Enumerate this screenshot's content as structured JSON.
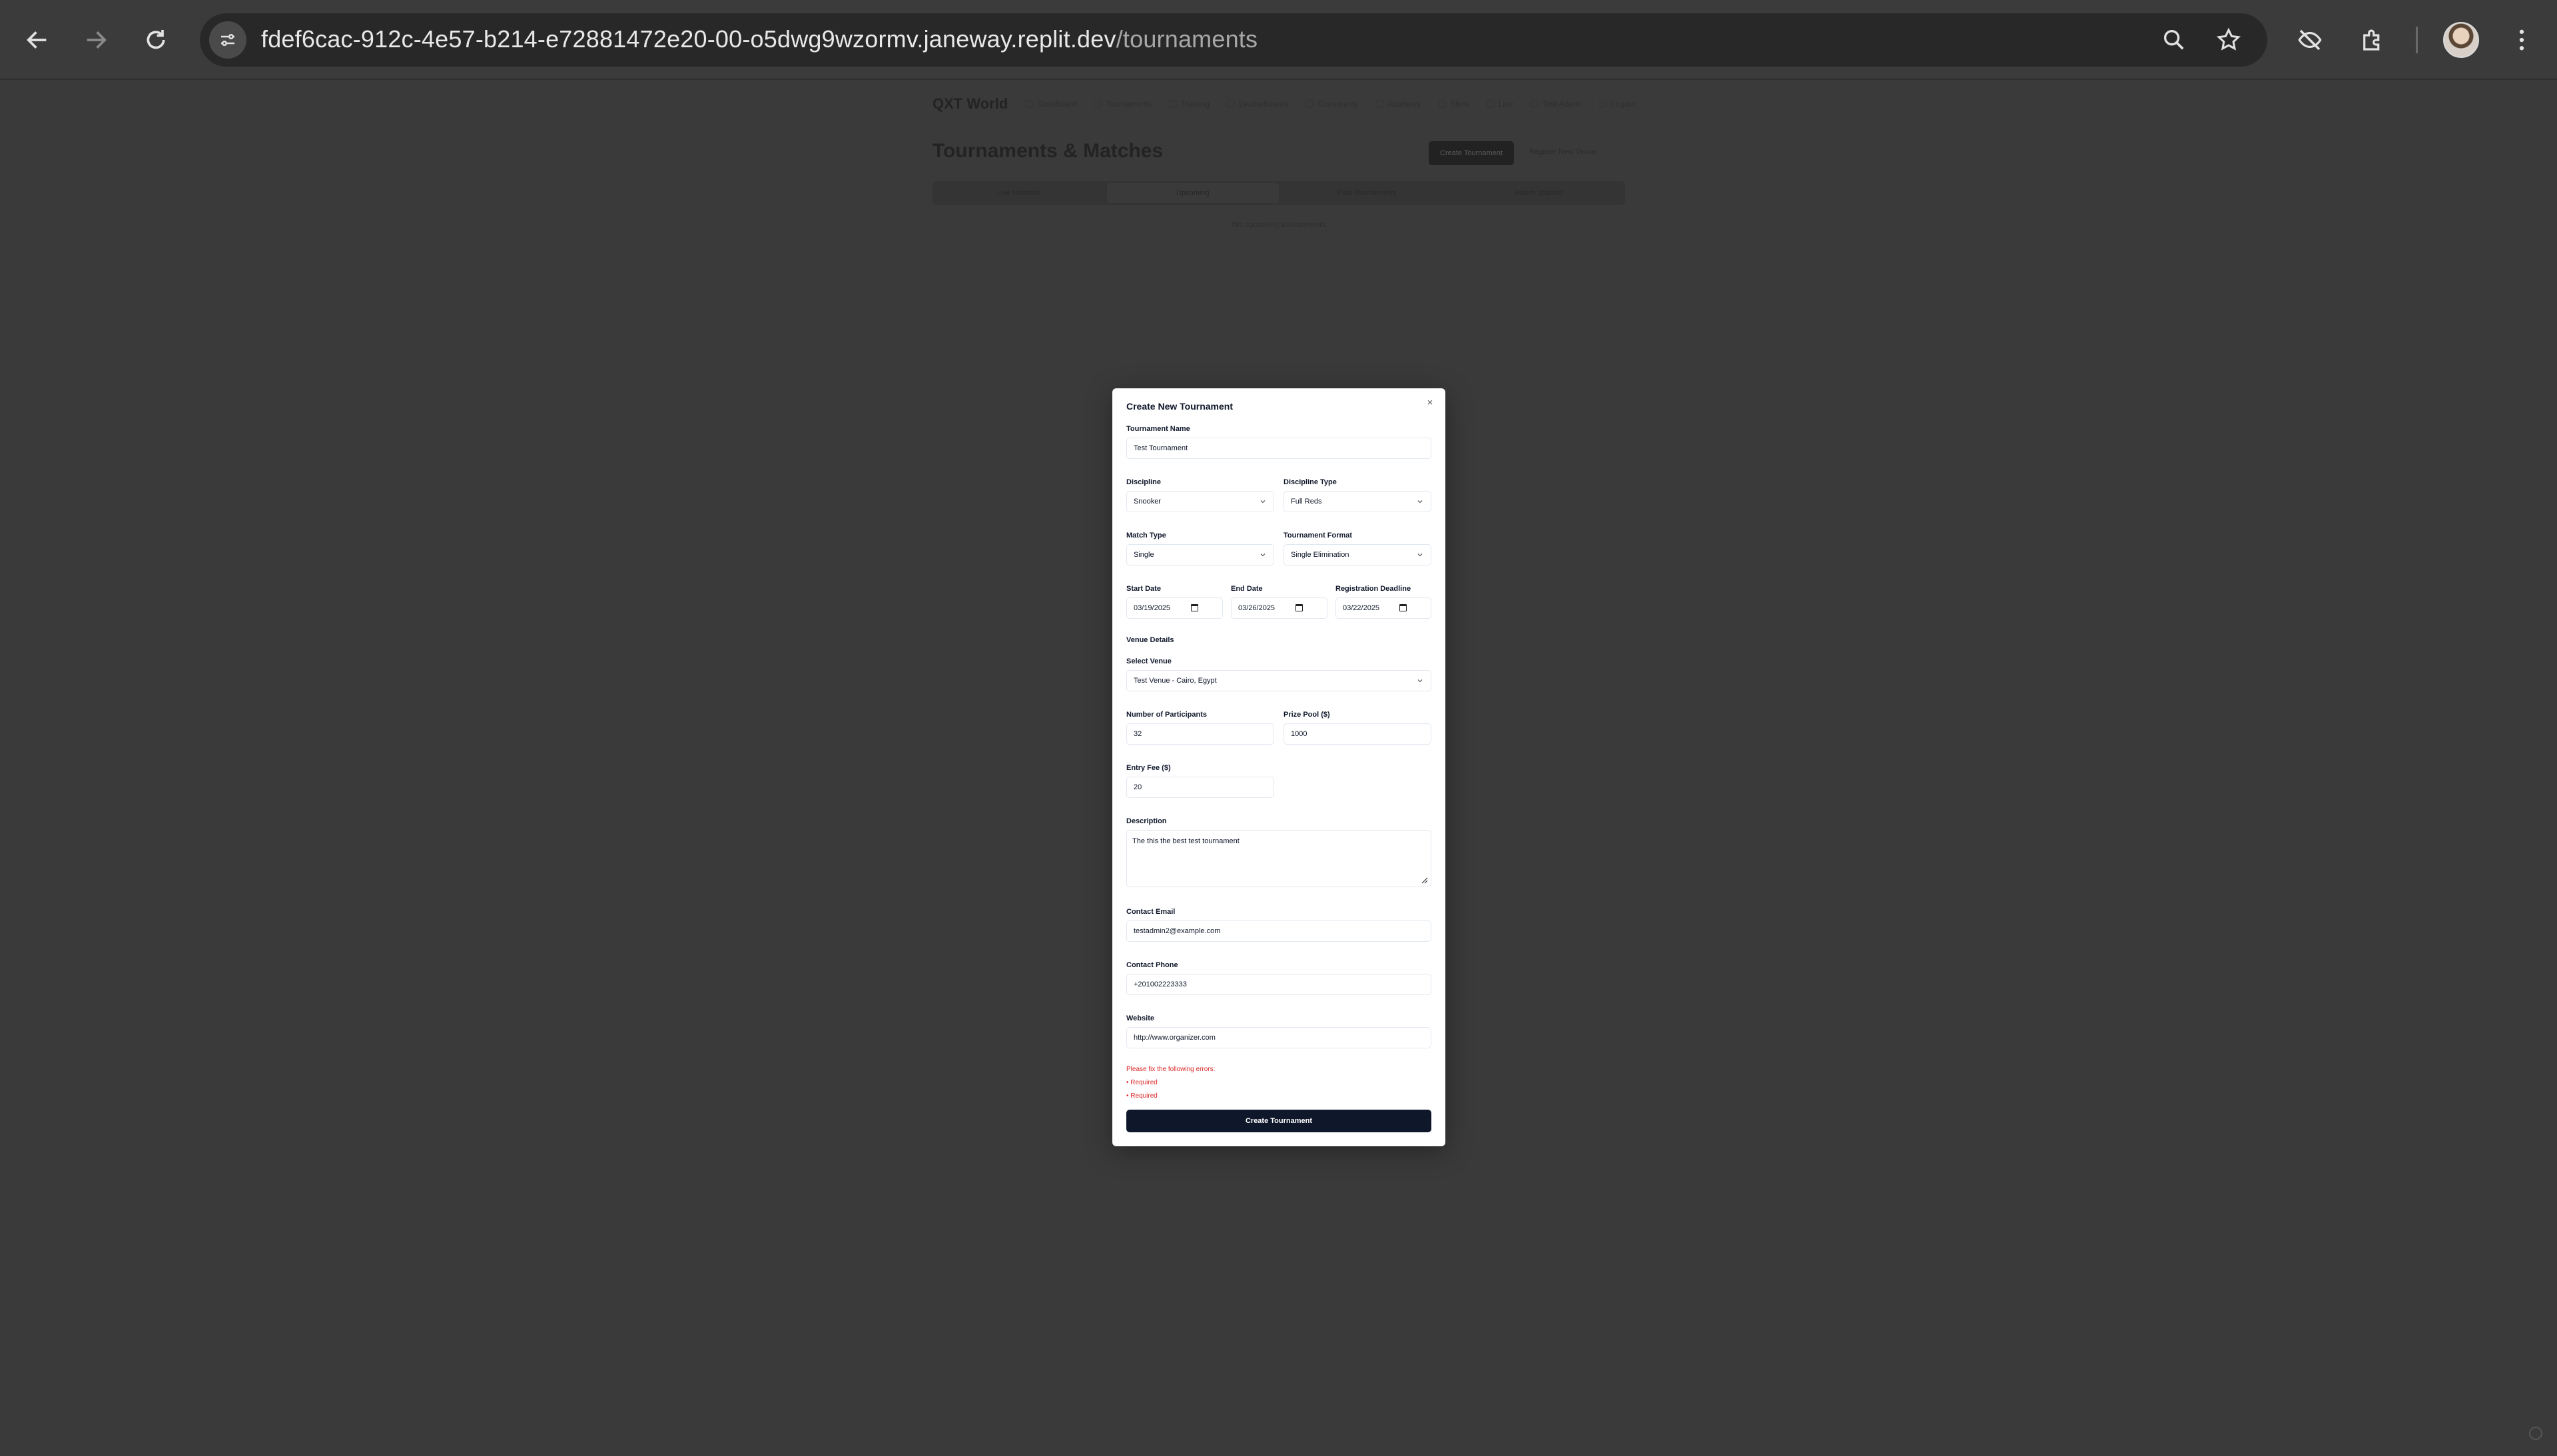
{
  "browser": {
    "url_host": "fdef6cac-912c-4e57-b214-e72881472e20-00-o5dwg9wzormv.janeway.replit.dev",
    "url_path": "/tournaments"
  },
  "app": {
    "brand": "QXT World",
    "nav": [
      "Dashboard",
      "Tournaments",
      "Training",
      "Leaderboards",
      "Community",
      "Academy",
      "Store",
      "Live",
      "Test Admin",
      "Logout"
    ],
    "page_title": "Tournaments & Matches",
    "create_button": "Create Tournament",
    "register_venue": "Register New Venue",
    "tabs": [
      "Live Matches",
      "Upcoming",
      "Past Tournaments",
      "Match Statistic"
    ],
    "empty_message": "No upcoming tournaments"
  },
  "modal": {
    "title": "Create New Tournament",
    "close_symbol": "×",
    "tournament_name": {
      "label": "Tournament Name",
      "value": "Test Tournament"
    },
    "discipline": {
      "label": "Discipline",
      "value": "Snooker"
    },
    "discipline_type": {
      "label": "Discipline Type",
      "value": "Full Reds"
    },
    "match_type": {
      "label": "Match Type",
      "value": "Single"
    },
    "tournament_format": {
      "label": "Tournament Format",
      "value": "Single Elimination"
    },
    "start_date": {
      "label": "Start Date",
      "value": "03/19/2025"
    },
    "end_date": {
      "label": "End Date",
      "value": "03/26/2025"
    },
    "registration_deadline": {
      "label": "Registration Deadline",
      "value": "03/22/2025"
    },
    "venue_section": "Venue Details",
    "select_venue": {
      "label": "Select Venue",
      "value": "Test Venue - Cairo, Egypt"
    },
    "participants": {
      "label": "Number of Participants",
      "value": "32"
    },
    "prize_pool": {
      "label": "Prize Pool ($)",
      "value": "1000"
    },
    "entry_fee": {
      "label": "Entry Fee ($)",
      "value": "20"
    },
    "description": {
      "label": "Description",
      "value": "The this the best test tournament"
    },
    "contact_email": {
      "label": "Contact Email",
      "value": "testadmin2@example.com"
    },
    "contact_phone": {
      "label": "Contact Phone",
      "value": "+201002223333"
    },
    "website": {
      "label": "Website",
      "value": "http://www.organizer.com"
    },
    "errors": {
      "heading": "Please fix the following errors:",
      "items": [
        "• Required",
        "• Required"
      ]
    },
    "submit": "Create Tournament"
  },
  "colors": {
    "primary": "#0f172a",
    "error": "#dc2626",
    "backdrop": "#3a3a3a"
  }
}
